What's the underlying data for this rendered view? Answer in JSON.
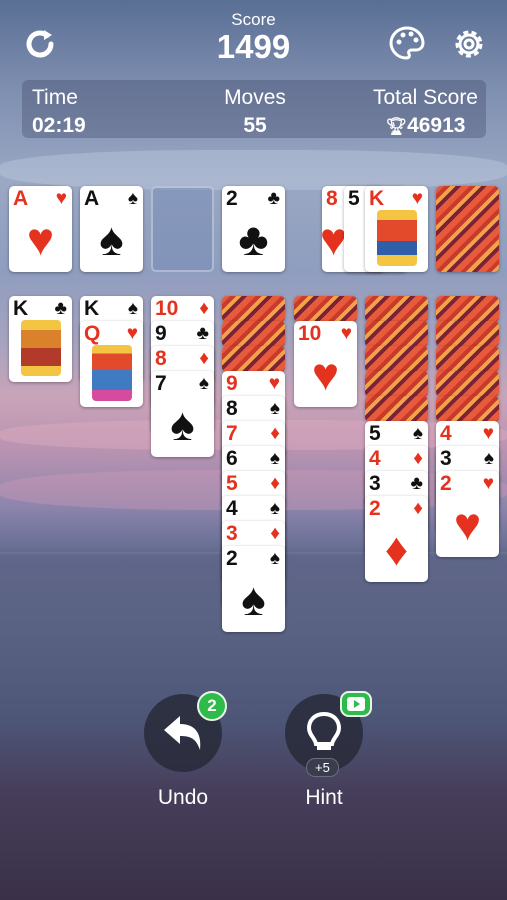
{
  "header": {
    "score_label": "Score",
    "score_value": "1499"
  },
  "stats": {
    "time_label": "Time",
    "time_value": "02:19",
    "moves_label": "Moves",
    "moves_value": "55",
    "total_label": "Total Score",
    "total_value": "46913"
  },
  "foundations": [
    {
      "rank": "A",
      "suit": "♥",
      "color": "red"
    },
    {
      "rank": "A",
      "suit": "♠",
      "color": "black"
    },
    {
      "rank": "",
      "suit": "",
      "color": ""
    },
    {
      "rank": "2",
      "suit": "♣",
      "color": "black"
    }
  ],
  "waste": [
    {
      "rank": "8",
      "suit": "♥"
    },
    {
      "rank": "5",
      "suit": "♠"
    },
    {
      "rank": "K",
      "suit": "♥"
    }
  ],
  "tableau": {
    "col1": [
      {
        "rank": "K",
        "suit": "♣"
      }
    ],
    "col2": [
      {
        "rank": "K",
        "suit": "♠"
      },
      {
        "rank": "Q",
        "suit": "♥"
      }
    ],
    "col3": [
      {
        "rank": "10",
        "suit": "♦"
      },
      {
        "rank": "9",
        "suit": "♣"
      },
      {
        "rank": "8",
        "suit": "♦"
      },
      {
        "rank": "7",
        "suit": "♠"
      }
    ],
    "col4": [
      {
        "rank": "9",
        "suit": "♥"
      },
      {
        "rank": "8",
        "suit": "♠"
      },
      {
        "rank": "7",
        "suit": "♦"
      },
      {
        "rank": "6",
        "suit": "♠"
      },
      {
        "rank": "5",
        "suit": "♦"
      },
      {
        "rank": "4",
        "suit": "♠"
      },
      {
        "rank": "3",
        "suit": "♦"
      },
      {
        "rank": "2",
        "suit": "♠"
      }
    ],
    "col5": [
      {
        "rank": "10",
        "suit": "♥"
      }
    ],
    "col6": [
      {
        "rank": "5",
        "suit": "♠"
      },
      {
        "rank": "4",
        "suit": "♦"
      },
      {
        "rank": "3",
        "suit": "♣"
      },
      {
        "rank": "2",
        "suit": "♦"
      }
    ],
    "col7": [
      {
        "rank": "4",
        "suit": "♥"
      },
      {
        "rank": "3",
        "suit": "♠"
      },
      {
        "rank": "2",
        "suit": "♥"
      }
    ]
  },
  "buttons": {
    "undo_label": "Undo",
    "undo_badge": "2",
    "hint_label": "Hint",
    "hint_bonus": "+5"
  },
  "icons": [
    "restart-icon",
    "palette-icon",
    "gear-icon",
    "trophy-icon",
    "undo-arrow-icon",
    "lightbulb-icon",
    "video-icon"
  ]
}
